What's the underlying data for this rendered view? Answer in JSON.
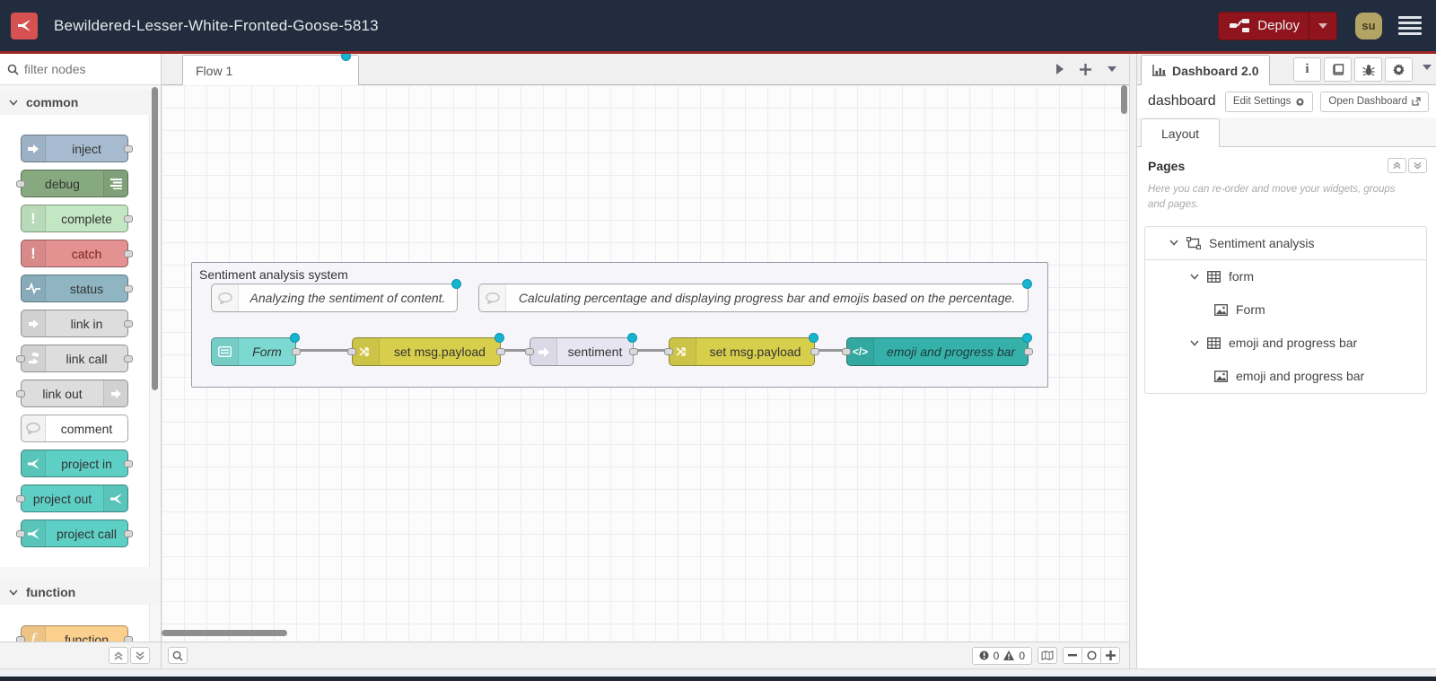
{
  "header": {
    "title": "Bewildered-Lesser-White-Fronted-Goose-5813",
    "deploy_label": "Deploy",
    "user_initials": "su"
  },
  "palette": {
    "filter_placeholder": "filter nodes",
    "categories": [
      {
        "label": "common",
        "nodes": [
          {
            "label": "inject"
          },
          {
            "label": "debug"
          },
          {
            "label": "complete"
          },
          {
            "label": "catch"
          },
          {
            "label": "status"
          },
          {
            "label": "link in"
          },
          {
            "label": "link call"
          },
          {
            "label": "link out"
          },
          {
            "label": "comment"
          },
          {
            "label": "project in"
          },
          {
            "label": "project out"
          },
          {
            "label": "project call"
          }
        ]
      },
      {
        "label": "function",
        "nodes": [
          {
            "label": "function"
          }
        ]
      }
    ]
  },
  "workspace": {
    "tab_label": "Flow 1",
    "group_label": "Sentiment analysis system",
    "comments": [
      {
        "text": "Analyzing the sentiment of content."
      },
      {
        "text": "Calculating percentage and displaying progress bar and emojis based on the percentage."
      }
    ],
    "nodes": [
      {
        "label": "Form"
      },
      {
        "label": "set msg.payload"
      },
      {
        "label": "sentiment"
      },
      {
        "label": "set msg.payload"
      },
      {
        "label": "emoji and progress bar"
      }
    ]
  },
  "statusbar": {
    "error_count": "0",
    "warning_count": "0"
  },
  "sidebar": {
    "tab_label": "Dashboard 2.0",
    "subtitle": "dashboard",
    "edit_settings_label": "Edit Settings",
    "open_dashboard_label": "Open Dashboard",
    "layout_tab_label": "Layout",
    "pages_title": "Pages",
    "help_text": "Here you can re-order and move your widgets, groups and pages.",
    "tree": [
      {
        "label": "Sentiment analysis",
        "icon": "group-icon"
      },
      {
        "label": "form",
        "icon": "table-icon"
      },
      {
        "label": "Form",
        "icon": "image-icon"
      },
      {
        "label": "emoji and progress bar",
        "icon": "table-icon"
      },
      {
        "label": "emoji and progress bar",
        "icon": "image-icon"
      }
    ]
  },
  "colors": {
    "header_bg": "#212d3e",
    "accent_red": "#9e2626",
    "deploy_bg": "#8f141d",
    "logo_red": "#d65151",
    "avatar_bg": "#b3a465",
    "node_inject": "#a6bbcf",
    "node_debug": "#87a980",
    "node_complete": "#c3e6c3",
    "node_catch": "#e49191",
    "node_status": "#8fb5c3",
    "node_link": "#dddddd",
    "node_project": "#5ecfc5",
    "node_function": "#fbcf8e",
    "node_form": "#7cd9d1",
    "node_change": "#d7cf4c",
    "node_sentiment": "#e7e5f2",
    "node_template": "#36b1aa",
    "changed_dot": "#17b4cf",
    "wire": "#989898"
  }
}
